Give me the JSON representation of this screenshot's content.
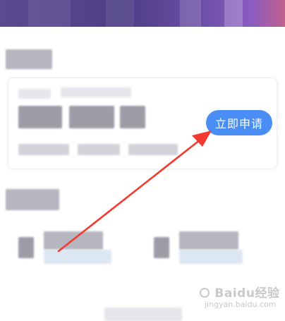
{
  "card": {
    "apply_button_label": "立即申请"
  },
  "watermark": {
    "brand": "Baidu经验",
    "url": "jingyan.baidu.com"
  },
  "colors": {
    "button": "#4a8df5",
    "arrow": "#f23a2e",
    "banner": "#5a4a90"
  }
}
